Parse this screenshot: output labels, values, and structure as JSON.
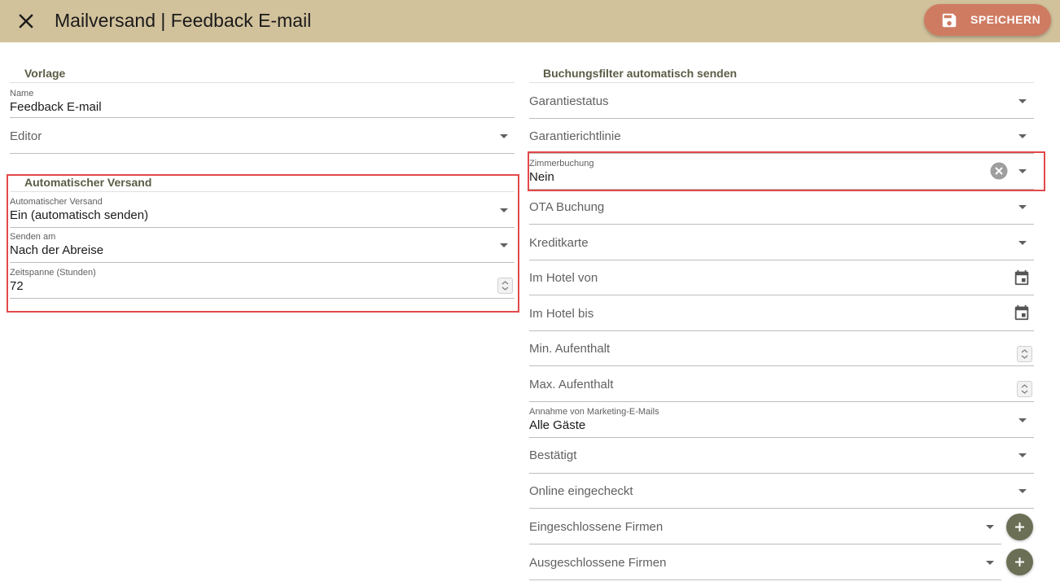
{
  "header": {
    "title": "Mailversand | Feedback E-mail",
    "save_label": "SPEICHERN",
    "close_icon": "close-icon",
    "save_icon": "floppy-disk-icon"
  },
  "colors": {
    "header_bg": "#d2c29c",
    "save_button": "#cf7b62",
    "highlight_border": "#e2494a",
    "add_button": "#6b6f55",
    "section_title": "#5c5c46"
  },
  "vorlage": {
    "title": "Vorlage",
    "name_label": "Name",
    "name_value": "Feedback E-mail",
    "editor_placeholder": "Editor"
  },
  "auto": {
    "title": "Automatischer Versand",
    "versand_label": "Automatischer Versand",
    "versand_value": "Ein (automatisch senden)",
    "senden_label": "Senden am",
    "senden_value": "Nach der Abreise",
    "zeit_label": "Zeitspanne (Stunden)",
    "zeit_value": "72"
  },
  "filter": {
    "title": "Buchungsfilter automatisch senden",
    "garantiestatus": "Garantiestatus",
    "garantierichtlinie": "Garantierichtlinie",
    "zimmer_label": "Zimmerbuchung",
    "zimmer_value": "Nein",
    "ota": "OTA Buchung",
    "kreditkarte": "Kreditkarte",
    "hotel_von": "Im Hotel von",
    "hotel_bis": "Im Hotel bis",
    "min_aufenthalt": "Min. Aufenthalt",
    "max_aufenthalt": "Max. Aufenthalt",
    "marketing_label": "Annahme von Marketing-E-Mails",
    "marketing_value": "Alle Gäste",
    "bestaetigt": "Bestätigt",
    "online": "Online eingecheckt",
    "eingeschlossen": "Eingeschlossene Firmen",
    "ausgeschlossen": "Ausgeschlossene Firmen"
  }
}
